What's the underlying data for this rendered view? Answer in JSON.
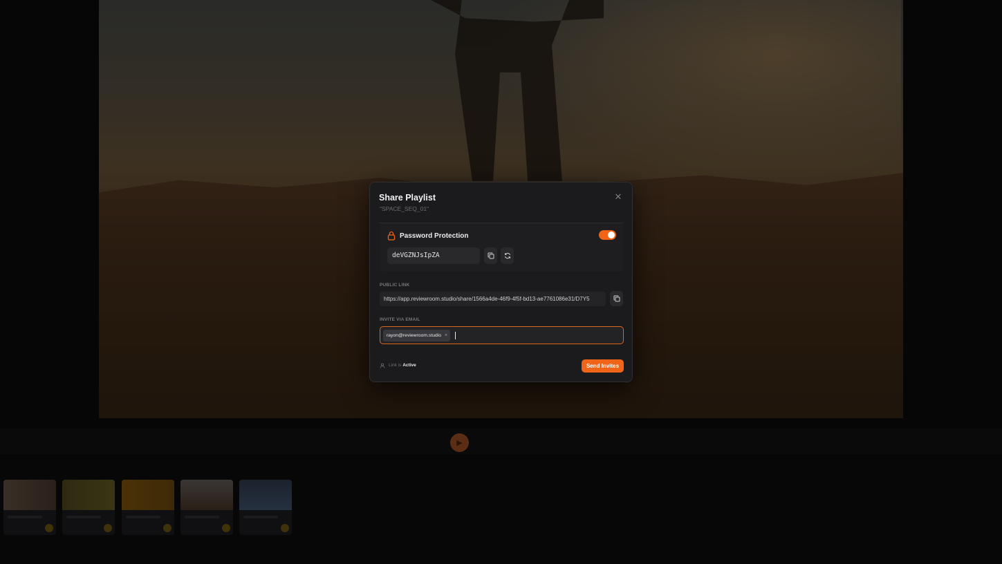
{
  "modal": {
    "title": "Share Playlist",
    "subtitle": "\"SPACE_SEQ_01\"",
    "close_icon": "close-icon",
    "password_protection": {
      "label": "Password Protection",
      "enabled": true,
      "password": "deVGZNJsIpZA",
      "icons": [
        "lock-icon",
        "copy-icon",
        "refresh-icon"
      ]
    },
    "public_link": {
      "label": "PUBLIC LINK",
      "url": "https://app.reviewroom.studio/share/1566a4de-46f9-4f5f-bd13-ae7761086e31/D7Y5"
    },
    "invite": {
      "label": "INVITE VIA EMAIL",
      "emails": [
        "rayon@reviewroom.studio"
      ],
      "remove_glyph": "×"
    },
    "status": {
      "prefix": "Link is ",
      "state": "Active"
    },
    "send_button": "Send Invites"
  },
  "colors": {
    "accent": "#f06418",
    "modal_bg": "#1b1b1d",
    "input_bg": "#242427"
  }
}
